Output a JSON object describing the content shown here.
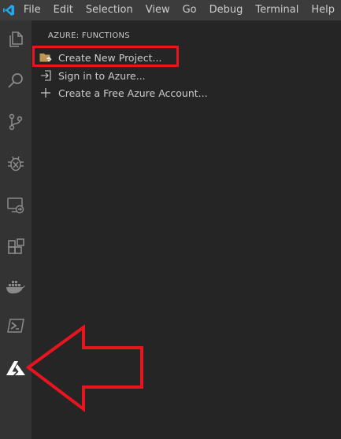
{
  "menubar": {
    "items": [
      "File",
      "Edit",
      "Selection",
      "View",
      "Go",
      "Debug",
      "Terminal",
      "Help"
    ]
  },
  "activity_bar": {
    "icons": [
      "explorer-icon",
      "search-icon",
      "source-control-icon",
      "debug-icon",
      "remote-explorer-icon",
      "extensions-icon",
      "docker-icon",
      "powershell-icon",
      "azure-icon"
    ]
  },
  "sidebar": {
    "title": "AZURE: FUNCTIONS",
    "items": [
      {
        "label": "Create New Project...",
        "icon": "folder-icon"
      },
      {
        "label": "Sign in to Azure...",
        "icon": "sign-in-icon"
      },
      {
        "label": "Create a Free Azure Account...",
        "icon": "plus-icon"
      }
    ]
  },
  "annotations": {
    "highlight_color": "#e8151f",
    "arrow_color": "#e8151f"
  },
  "colors": {
    "menubar_bg": "#3c3c3c",
    "activitybar_bg": "#333333",
    "sidebar_bg": "#252526",
    "text": "#cccccc",
    "vscode_blue": "#23a9f2"
  }
}
